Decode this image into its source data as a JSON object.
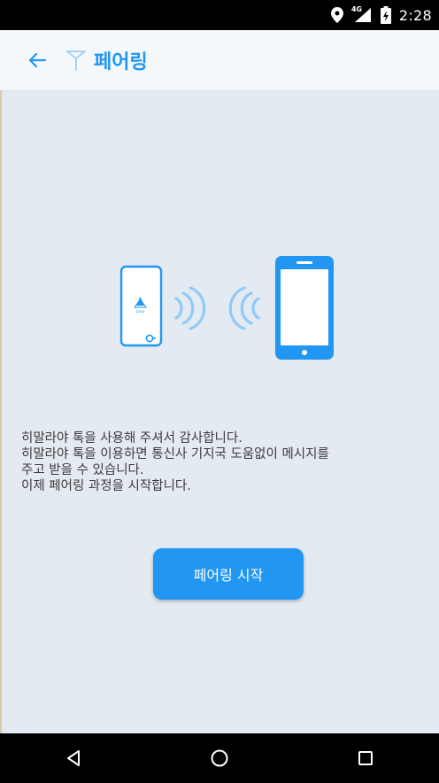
{
  "status_bar": {
    "time": "2:28",
    "network": "4G",
    "icons": [
      "location-icon",
      "signal-icon",
      "battery-charging-icon"
    ]
  },
  "app_bar": {
    "title": "페어링",
    "back_icon": "back-arrow-icon",
    "logo_icon": "antenna-icon"
  },
  "illustration": {
    "device_label": "Lory",
    "accent_color": "#2196f3"
  },
  "message": "히말라야 톡을 사용해 주셔서 감사합니다.\n히말라야 톡을 이용하면 통신사 기지국 도움없이 메시지를\n주고 받을 수 있습니다.\n이제 페어링 과정을 시작합니다.",
  "start_button": {
    "label": "페어링 시작"
  },
  "nav_bar": {
    "icons": [
      "back-triangle-icon",
      "home-circle-icon",
      "recents-square-icon"
    ]
  }
}
